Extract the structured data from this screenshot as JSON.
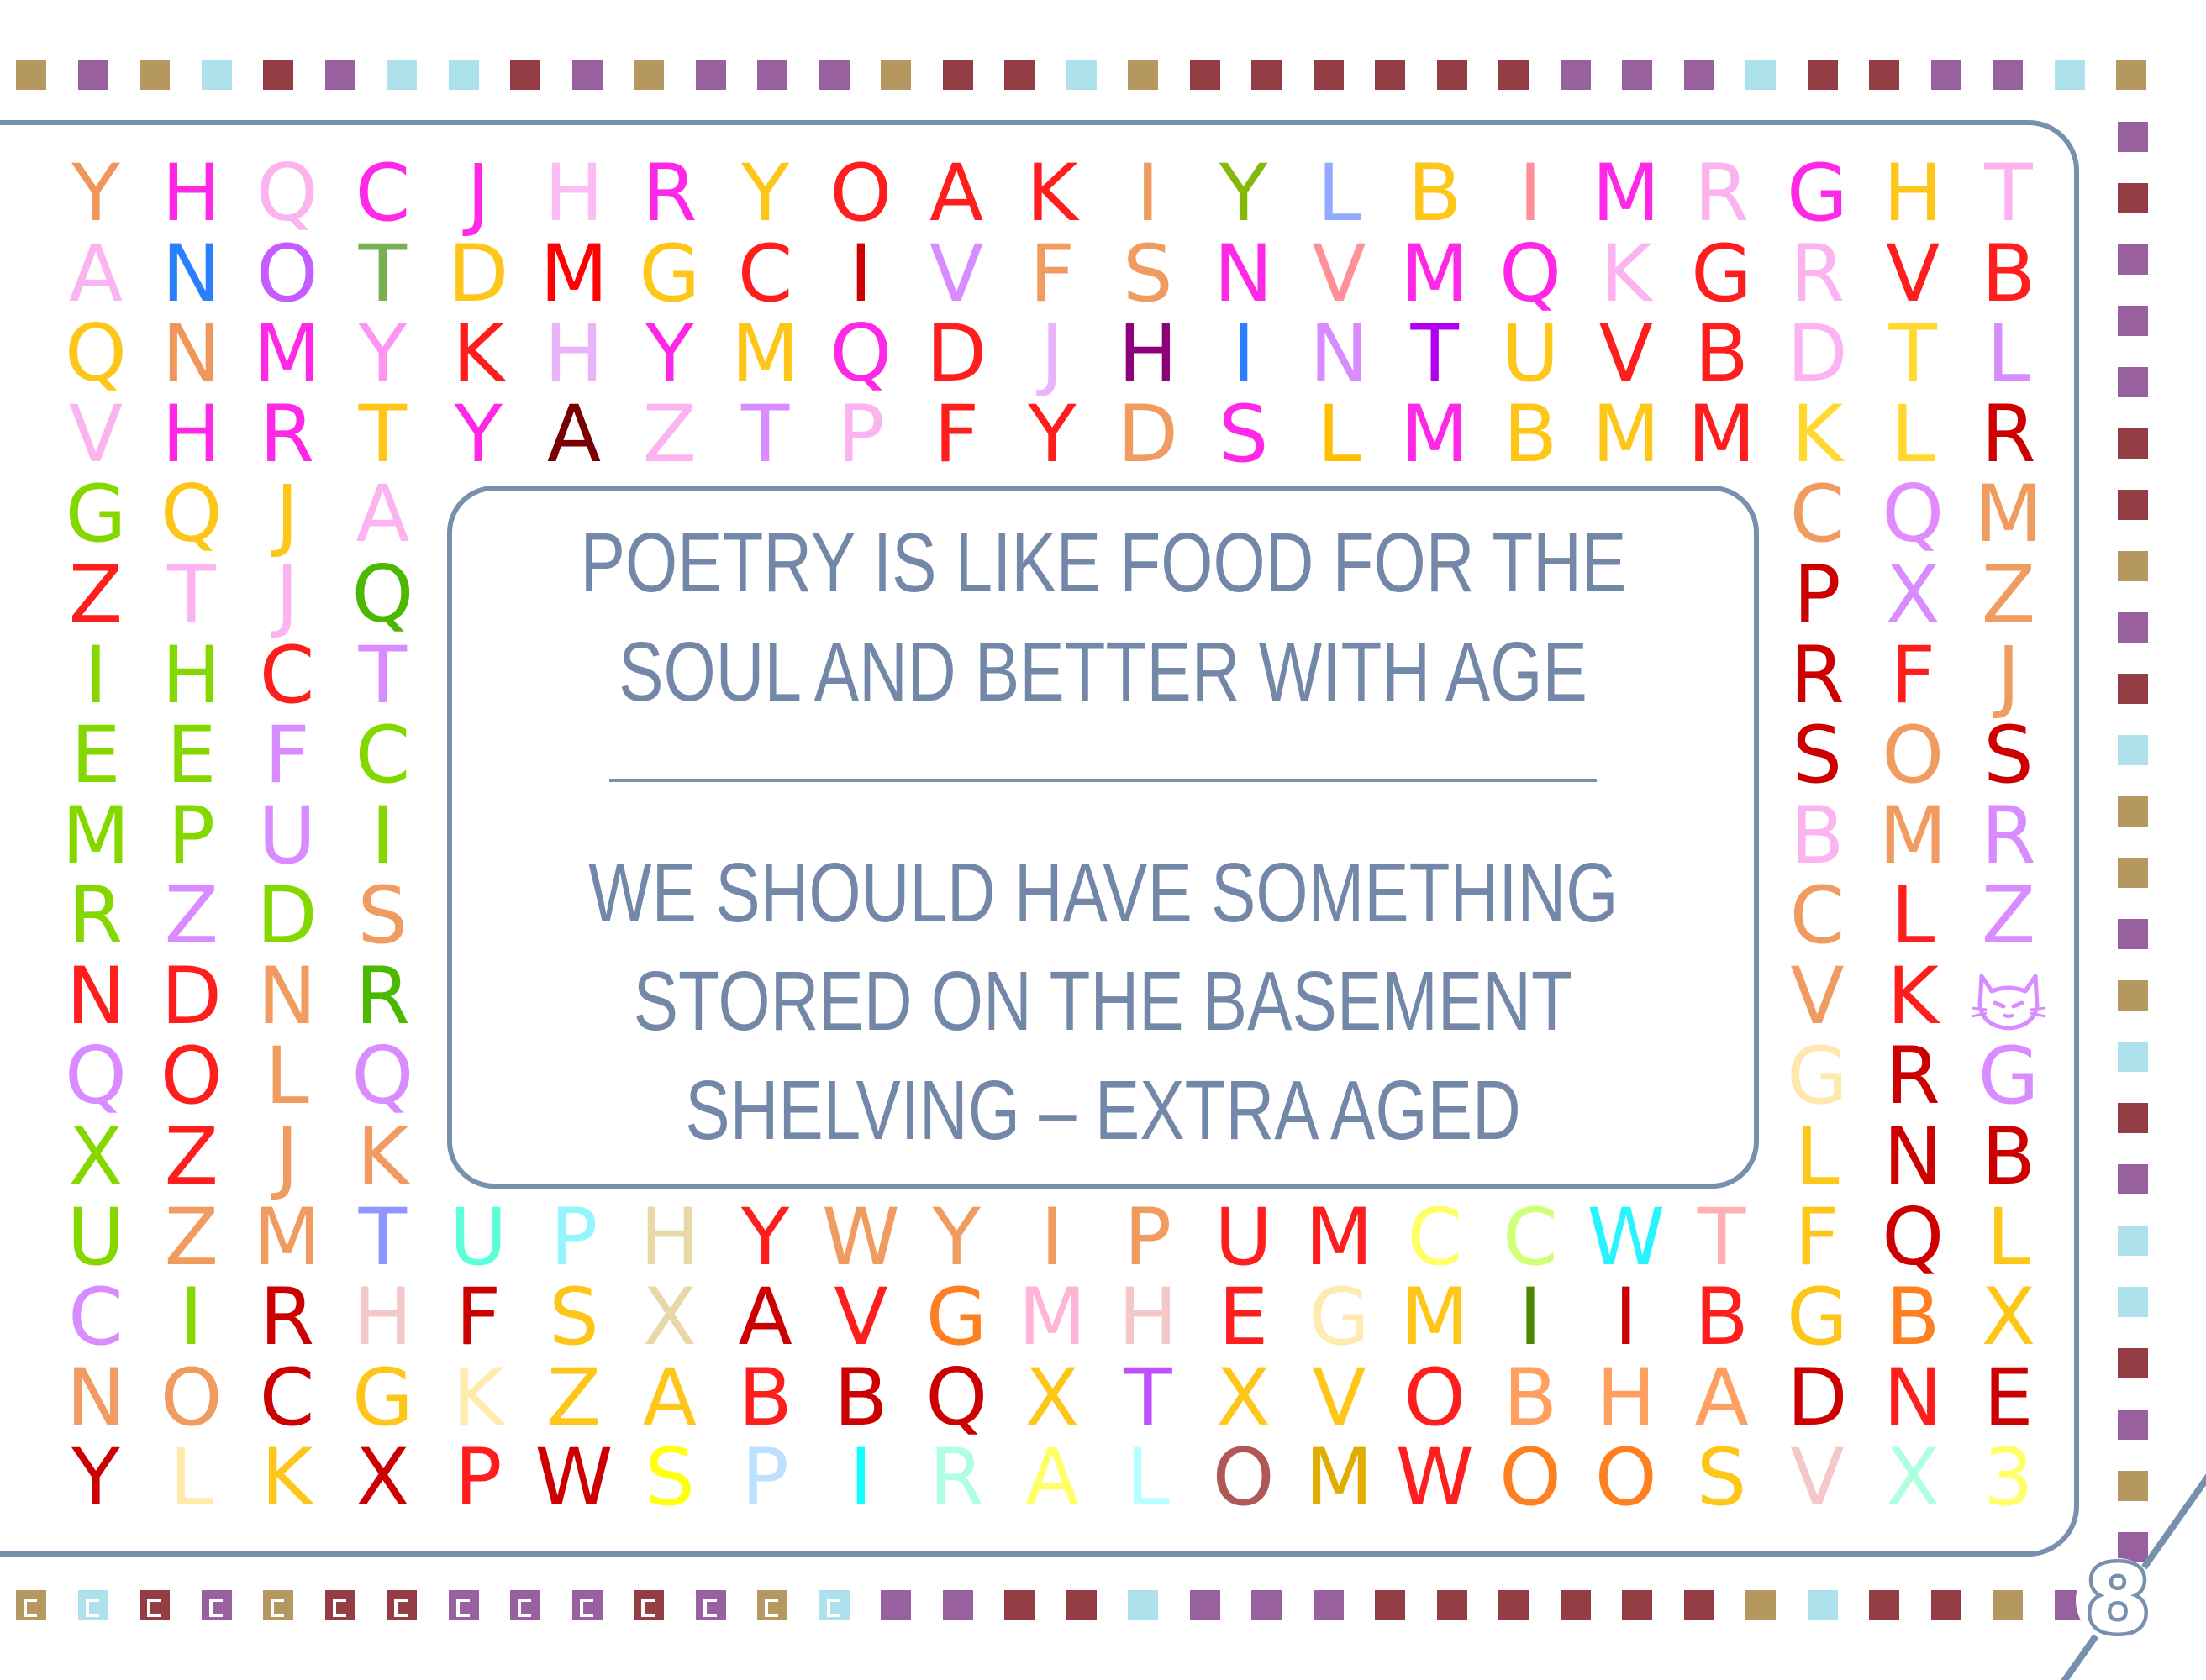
{
  "border_colors": {
    "t": "#b5985f",
    "p": "#98609f",
    "b": "#ade1ec",
    "m": "#943d45"
  },
  "frame_color": "#7690ae",
  "top_border": "tptbmpbbmptppptmmbtmmmmmmpppbmmppbt",
  "right_border": "pmpppmmtpmbttptbmpbbmptp",
  "bottom_border": "tbmptmmpppmptbppmmbpppmmmmmmtbmmtp",
  "bottom_patterned_count": 14,
  "quote": {
    "text_color": "#7388a8",
    "lines_top": [
      "POETRY IS LIKE FOOD FOR THE",
      "SOUL AND BETTER WITH AGE"
    ],
    "lines_bottom": [
      "WE SHOULD HAVE SOMETHING",
      "STORED ON THE BASEMENT",
      "SHELVING – EXTRA AGED"
    ]
  },
  "page_number": "8",
  "grid": {
    "columns": 21,
    "rows": [
      {
        "letters": [
          "Y",
          "H",
          "Q",
          "C",
          "J",
          "H",
          "R",
          "Y",
          "O",
          "A",
          "K",
          "I",
          "Y",
          "L",
          "B",
          "I",
          "M",
          "R",
          "G",
          "H",
          "T"
        ],
        "colors": [
          "#f0965a",
          "#ff28e6",
          "#fcb4f0",
          "#ff28e6",
          "#ff28e6",
          "#fcbcf4",
          "#ff28e6",
          "#ffc61a",
          "#ff1e1e",
          "#ff1e1e",
          "#ff1e1e",
          "#f09c60",
          "#84b80a",
          "#94aaff",
          "#ffc61a",
          "#ff9098",
          "#ff28e6",
          "#fcb4f0",
          "#ff28e6",
          "#ffc61a",
          "#fcb4f0"
        ]
      },
      {
        "letters": [
          "A",
          "N",
          "O",
          "T",
          "D",
          "M",
          "G",
          "C",
          "I",
          "V",
          "F",
          "S",
          "N",
          "V",
          "M",
          "Q",
          "K",
          "G",
          "R",
          "V",
          "B"
        ],
        "colors": [
          "#fcb4f0",
          "#2a7fff",
          "#c45cff",
          "#78b050",
          "#ffc61a",
          "#ff0000",
          "#ffc61a",
          "#ff1e1e",
          "#cc0000",
          "#d88cff",
          "#f09c60",
          "#f09c60",
          "#ff28e6",
          "#ff9098",
          "#ff28e6",
          "#ff28e6",
          "#fcb4f0",
          "#ff1e1e",
          "#fcb4f0",
          "#ff1e1e",
          "#ff1e1e"
        ]
      },
      {
        "letters": [
          "Q",
          "N",
          "M",
          "Y",
          "K",
          "H",
          "Y",
          "M",
          "Q",
          "D",
          "J",
          "H",
          "I",
          "N",
          "T",
          "U",
          "V",
          "B",
          "D",
          "T",
          "L"
        ],
        "colors": [
          "#ffc61a",
          "#f0965a",
          "#ff28e6",
          "#fc96f0",
          "#ff1e1e",
          "#e8b4fc",
          "#ff28e6",
          "#ffc61a",
          "#ff28e6",
          "#ff1e1e",
          "#e8b4fc",
          "#8c0078",
          "#2a7fff",
          "#d88cff",
          "#b000f0",
          "#ffc61a",
          "#ff1e1e",
          "#ff1e1e",
          "#fcb4f0",
          "#ffd830",
          "#d88cff"
        ]
      },
      {
        "letters": [
          "V",
          "H",
          "R",
          "T",
          "Y",
          "A",
          "Z",
          "T",
          "P",
          "F",
          "Y",
          "D",
          "S",
          "L",
          "M",
          "B",
          "M",
          "M",
          "K",
          "L",
          "R"
        ],
        "colors": [
          "#fcb4f0",
          "#ff28e6",
          "#ff28e6",
          "#ffc61a",
          "#ff28e6",
          "#780000",
          "#fcb4f0",
          "#d88cff",
          "#fcb4f0",
          "#ff1e1e",
          "#ff1e1e",
          "#f09c60",
          "#ff28e6",
          "#ffc000",
          "#ff28e6",
          "#ffc61a",
          "#ffc61a",
          "#ff1e1e",
          "#ffd830",
          "#ffd830",
          "#cc0000"
        ]
      },
      {
        "letters": [
          "G",
          "Q",
          "J",
          "A",
          "C",
          "Q",
          "M"
        ],
        "colors": [
          "#84d800",
          "#ffc61a",
          "#ffc61a",
          "#fcb4f0",
          "#f09c60",
          "#e08cff",
          "#f09c60"
        ]
      },
      {
        "letters": [
          "Z",
          "T",
          "J",
          "Q",
          "P",
          "X",
          "Z"
        ],
        "colors": [
          "#ff1e1e",
          "#fcb4f0",
          "#fcb4f0",
          "#4cb800",
          "#cc0000",
          "#d88cff",
          "#f09c60"
        ]
      },
      {
        "letters": [
          "I",
          "H",
          "C",
          "T",
          "R",
          "F",
          "J"
        ],
        "colors": [
          "#84d800",
          "#84d800",
          "#ff1e1e",
          "#d88cff",
          "#cc0000",
          "#ff1e1e",
          "#f09c60"
        ]
      },
      {
        "letters": [
          "E",
          "E",
          "F",
          "C",
          "S",
          "O",
          "S"
        ],
        "colors": [
          "#84d800",
          "#84d800",
          "#d88cff",
          "#84d800",
          "#cc0000",
          "#f09c60",
          "#cc0000"
        ]
      },
      {
        "letters": [
          "M",
          "P",
          "U",
          "I",
          "B",
          "M",
          "R"
        ],
        "colors": [
          "#84d800",
          "#84d800",
          "#d88cff",
          "#84d800",
          "#fcb4f0",
          "#f09c60",
          "#d88cff"
        ]
      },
      {
        "letters": [
          "R",
          "Z",
          "D",
          "S",
          "C",
          "L",
          "Z"
        ],
        "colors": [
          "#84d800",
          "#d88cff",
          "#84d800",
          "#f09c60",
          "#f09c60",
          "#ff1e1e",
          "#d88cff"
        ]
      },
      {
        "letters": [
          "N",
          "D",
          "N",
          "R",
          "V",
          "K",
          ""
        ],
        "colors": [
          "#ff1e1e",
          "#ff1e1e",
          "#f09c60",
          "#4cb800",
          "#f09c60",
          "#ff1e1e",
          "#d88cff"
        ],
        "icon": "cat-icon"
      },
      {
        "letters": [
          "Q",
          "O",
          "L",
          "Q",
          "G",
          "R",
          "G"
        ],
        "colors": [
          "#d88cff",
          "#ff1e1e",
          "#f09c60",
          "#d88cff",
          "#ffe8b0",
          "#cc0000",
          "#d88cff"
        ]
      },
      {
        "letters": [
          "X",
          "Z",
          "J",
          "K",
          "L",
          "N",
          "B"
        ],
        "colors": [
          "#84d800",
          "#ff1e1e",
          "#f09c60",
          "#f09c60",
          "#ffc61a",
          "#cc0000",
          "#cc0000"
        ]
      },
      {
        "letters": [
          "U",
          "Z",
          "M",
          "T",
          "U",
          "P",
          "H",
          "Y",
          "W",
          "Y",
          "I",
          "P",
          "U",
          "M",
          "C",
          "C",
          "W",
          "T",
          "F",
          "Q",
          "L"
        ],
        "colors": [
          "#84d800",
          "#f09c60",
          "#f09c60",
          "#9096ff",
          "#5cffd8",
          "#96f4ff",
          "#e8d8a8",
          "#ff1e1e",
          "#f09c60",
          "#f09c60",
          "#f09c60",
          "#f09c60",
          "#ff1e1e",
          "#ff1e1e",
          "#ffff68",
          "#d0ff78",
          "#28f4ff",
          "#ffb0b0",
          "#ffc61a",
          "#cc0000",
          "#ffc61a"
        ]
      },
      {
        "letters": [
          "C",
          "I",
          "R",
          "H",
          "F",
          "S",
          "X",
          "A",
          "V",
          "G",
          "M",
          "H",
          "E",
          "G",
          "M",
          "I",
          "I",
          "B",
          "G",
          "B",
          "X"
        ],
        "colors": [
          "#d88cff",
          "#84d800",
          "#cc0000",
          "#f4c8c8",
          "#cc0000",
          "#ffc61a",
          "#e8d8a8",
          "#cc0000",
          "#ff1e1e",
          "#ff8020",
          "#ffb4d8",
          "#f4c8c8",
          "#ff1e1e",
          "#ffeab0",
          "#ffc61a",
          "#4c8800",
          "#cc0000",
          "#ff1e1e",
          "#ffc61a",
          "#ff8020",
          "#ffc61a"
        ]
      },
      {
        "letters": [
          "N",
          "O",
          "C",
          "G",
          "K",
          "Z",
          "A",
          "B",
          "B",
          "Q",
          "X",
          "T",
          "X",
          "V",
          "O",
          "B",
          "H",
          "A",
          "D",
          "N",
          "E"
        ],
        "colors": [
          "#f09c60",
          "#f09c60",
          "#cc0000",
          "#ffc61a",
          "#ffeab0",
          "#ffc61a",
          "#ffc61a",
          "#ff1e1e",
          "#cc0000",
          "#cc0000",
          "#ffc61a",
          "#c050ff",
          "#ffc61a",
          "#ffc61a",
          "#ff1e1e",
          "#ffa060",
          "#ffa060",
          "#ffa060",
          "#cc0000",
          "#ff1e1e",
          "#cc0000"
        ]
      },
      {
        "letters": [
          "Y",
          "L",
          "K",
          "X",
          "P",
          "W",
          "S",
          "P",
          "I",
          "R",
          "A",
          "L",
          "O",
          "M",
          "W",
          "O",
          "O",
          "S",
          "V",
          "X",
          "3"
        ],
        "colors": [
          "#cc0000",
          "#ffeab0",
          "#ffc61a",
          "#cc0000",
          "#ff1e1e",
          "#cc0000",
          "#ffff10",
          "#bce0ff",
          "#10ffff",
          "#b0ffe0",
          "#ffff68",
          "#b8ffff",
          "#b05858",
          "#e0ac00",
          "#ff1e1e",
          "#ff8020",
          "#ff8020",
          "#ffc61a",
          "#f4c8c8",
          "#b0ffe0",
          "#ffff68"
        ]
      }
    ]
  }
}
